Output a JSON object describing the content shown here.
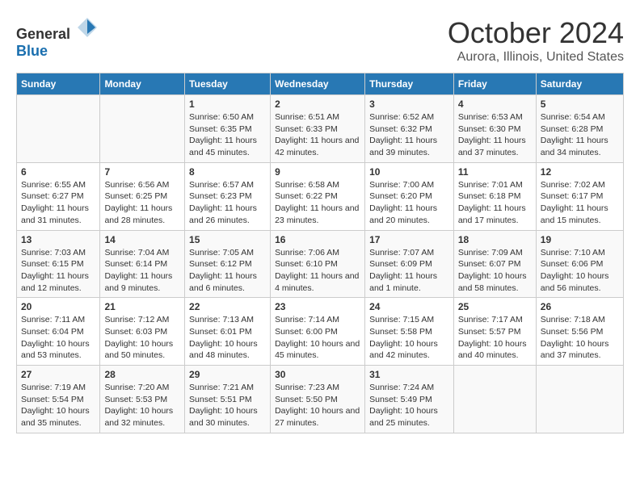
{
  "logo": {
    "general": "General",
    "blue": "Blue"
  },
  "title": "October 2024",
  "subtitle": "Aurora, Illinois, United States",
  "headers": [
    "Sunday",
    "Monday",
    "Tuesday",
    "Wednesday",
    "Thursday",
    "Friday",
    "Saturday"
  ],
  "weeks": [
    [
      {
        "day": "",
        "sunrise": "",
        "sunset": "",
        "daylight": ""
      },
      {
        "day": "",
        "sunrise": "",
        "sunset": "",
        "daylight": ""
      },
      {
        "day": "1",
        "sunrise": "Sunrise: 6:50 AM",
        "sunset": "Sunset: 6:35 PM",
        "daylight": "Daylight: 11 hours and 45 minutes."
      },
      {
        "day": "2",
        "sunrise": "Sunrise: 6:51 AM",
        "sunset": "Sunset: 6:33 PM",
        "daylight": "Daylight: 11 hours and 42 minutes."
      },
      {
        "day": "3",
        "sunrise": "Sunrise: 6:52 AM",
        "sunset": "Sunset: 6:32 PM",
        "daylight": "Daylight: 11 hours and 39 minutes."
      },
      {
        "day": "4",
        "sunrise": "Sunrise: 6:53 AM",
        "sunset": "Sunset: 6:30 PM",
        "daylight": "Daylight: 11 hours and 37 minutes."
      },
      {
        "day": "5",
        "sunrise": "Sunrise: 6:54 AM",
        "sunset": "Sunset: 6:28 PM",
        "daylight": "Daylight: 11 hours and 34 minutes."
      }
    ],
    [
      {
        "day": "6",
        "sunrise": "Sunrise: 6:55 AM",
        "sunset": "Sunset: 6:27 PM",
        "daylight": "Daylight: 11 hours and 31 minutes."
      },
      {
        "day": "7",
        "sunrise": "Sunrise: 6:56 AM",
        "sunset": "Sunset: 6:25 PM",
        "daylight": "Daylight: 11 hours and 28 minutes."
      },
      {
        "day": "8",
        "sunrise": "Sunrise: 6:57 AM",
        "sunset": "Sunset: 6:23 PM",
        "daylight": "Daylight: 11 hours and 26 minutes."
      },
      {
        "day": "9",
        "sunrise": "Sunrise: 6:58 AM",
        "sunset": "Sunset: 6:22 PM",
        "daylight": "Daylight: 11 hours and 23 minutes."
      },
      {
        "day": "10",
        "sunrise": "Sunrise: 7:00 AM",
        "sunset": "Sunset: 6:20 PM",
        "daylight": "Daylight: 11 hours and 20 minutes."
      },
      {
        "day": "11",
        "sunrise": "Sunrise: 7:01 AM",
        "sunset": "Sunset: 6:18 PM",
        "daylight": "Daylight: 11 hours and 17 minutes."
      },
      {
        "day": "12",
        "sunrise": "Sunrise: 7:02 AM",
        "sunset": "Sunset: 6:17 PM",
        "daylight": "Daylight: 11 hours and 15 minutes."
      }
    ],
    [
      {
        "day": "13",
        "sunrise": "Sunrise: 7:03 AM",
        "sunset": "Sunset: 6:15 PM",
        "daylight": "Daylight: 11 hours and 12 minutes."
      },
      {
        "day": "14",
        "sunrise": "Sunrise: 7:04 AM",
        "sunset": "Sunset: 6:14 PM",
        "daylight": "Daylight: 11 hours and 9 minutes."
      },
      {
        "day": "15",
        "sunrise": "Sunrise: 7:05 AM",
        "sunset": "Sunset: 6:12 PM",
        "daylight": "Daylight: 11 hours and 6 minutes."
      },
      {
        "day": "16",
        "sunrise": "Sunrise: 7:06 AM",
        "sunset": "Sunset: 6:10 PM",
        "daylight": "Daylight: 11 hours and 4 minutes."
      },
      {
        "day": "17",
        "sunrise": "Sunrise: 7:07 AM",
        "sunset": "Sunset: 6:09 PM",
        "daylight": "Daylight: 11 hours and 1 minute."
      },
      {
        "day": "18",
        "sunrise": "Sunrise: 7:09 AM",
        "sunset": "Sunset: 6:07 PM",
        "daylight": "Daylight: 10 hours and 58 minutes."
      },
      {
        "day": "19",
        "sunrise": "Sunrise: 7:10 AM",
        "sunset": "Sunset: 6:06 PM",
        "daylight": "Daylight: 10 hours and 56 minutes."
      }
    ],
    [
      {
        "day": "20",
        "sunrise": "Sunrise: 7:11 AM",
        "sunset": "Sunset: 6:04 PM",
        "daylight": "Daylight: 10 hours and 53 minutes."
      },
      {
        "day": "21",
        "sunrise": "Sunrise: 7:12 AM",
        "sunset": "Sunset: 6:03 PM",
        "daylight": "Daylight: 10 hours and 50 minutes."
      },
      {
        "day": "22",
        "sunrise": "Sunrise: 7:13 AM",
        "sunset": "Sunset: 6:01 PM",
        "daylight": "Daylight: 10 hours and 48 minutes."
      },
      {
        "day": "23",
        "sunrise": "Sunrise: 7:14 AM",
        "sunset": "Sunset: 6:00 PM",
        "daylight": "Daylight: 10 hours and 45 minutes."
      },
      {
        "day": "24",
        "sunrise": "Sunrise: 7:15 AM",
        "sunset": "Sunset: 5:58 PM",
        "daylight": "Daylight: 10 hours and 42 minutes."
      },
      {
        "day": "25",
        "sunrise": "Sunrise: 7:17 AM",
        "sunset": "Sunset: 5:57 PM",
        "daylight": "Daylight: 10 hours and 40 minutes."
      },
      {
        "day": "26",
        "sunrise": "Sunrise: 7:18 AM",
        "sunset": "Sunset: 5:56 PM",
        "daylight": "Daylight: 10 hours and 37 minutes."
      }
    ],
    [
      {
        "day": "27",
        "sunrise": "Sunrise: 7:19 AM",
        "sunset": "Sunset: 5:54 PM",
        "daylight": "Daylight: 10 hours and 35 minutes."
      },
      {
        "day": "28",
        "sunrise": "Sunrise: 7:20 AM",
        "sunset": "Sunset: 5:53 PM",
        "daylight": "Daylight: 10 hours and 32 minutes."
      },
      {
        "day": "29",
        "sunrise": "Sunrise: 7:21 AM",
        "sunset": "Sunset: 5:51 PM",
        "daylight": "Daylight: 10 hours and 30 minutes."
      },
      {
        "day": "30",
        "sunrise": "Sunrise: 7:23 AM",
        "sunset": "Sunset: 5:50 PM",
        "daylight": "Daylight: 10 hours and 27 minutes."
      },
      {
        "day": "31",
        "sunrise": "Sunrise: 7:24 AM",
        "sunset": "Sunset: 5:49 PM",
        "daylight": "Daylight: 10 hours and 25 minutes."
      },
      {
        "day": "",
        "sunrise": "",
        "sunset": "",
        "daylight": ""
      },
      {
        "day": "",
        "sunrise": "",
        "sunset": "",
        "daylight": ""
      }
    ]
  ]
}
